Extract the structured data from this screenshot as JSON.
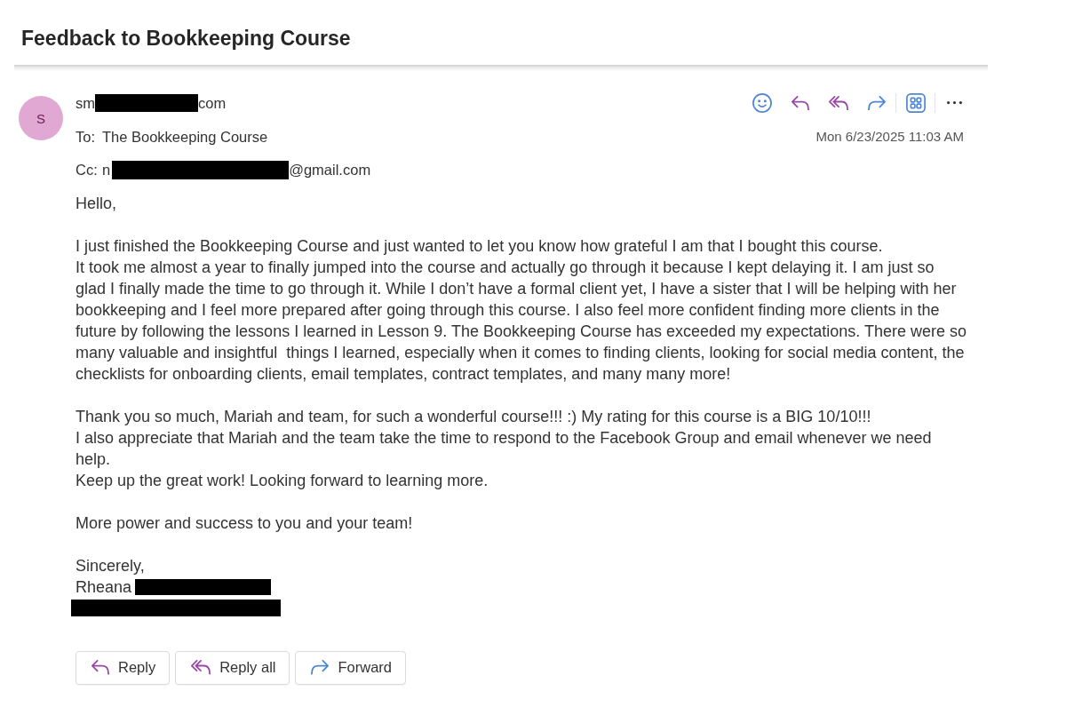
{
  "subject": "Feedback to Bookkeeping Course",
  "message": {
    "avatar_initial": "S",
    "sender": {
      "visible_start": "sm",
      "redacted": true,
      "visible_end": "com"
    },
    "to": {
      "label": "To:",
      "value": "The Bookkeeping Course"
    },
    "cc": {
      "label": "Cc:",
      "visible_start": "n",
      "redacted": true,
      "visible_end": "@gmail.com"
    },
    "date": "Mon 6/23/2025 11:03 AM"
  },
  "body": {
    "greeting": "Hello,",
    "paragraphs": [
      [
        "I just finished the Bookkeeping Course and just wanted to let you know how grateful I am that I bought this course.",
        "It took me almost a year to finally jumped into the course and actually go through it because I kept delaying it. I am just so glad I finally made the time to go through it. While I don’t have a formal client yet, I have a sister that I will be helping with her bookkeeping and I feel more prepared after going through this course. I also feel more confident finding more clients in the future by following the lessons I learned in Lesson 9. The Bookkeeping Course has exceeded my expectations. There were so many valuable and insightful  things I learned, especially when it comes to finding clients, looking for social media content, the checklists for onboarding clients, email templates, contract templates, and many many more!"
      ],
      [
        "Thank you so much, Mariah and team, for such a wonderful course!!! :) My rating for this course is a BIG 10/10!!!",
        "I also appreciate that Mariah and the team take the time to respond to the Facebook Group and email whenever we need help.",
        "Keep up the great work! Looking forward to learning more."
      ],
      [
        "More power and success to you and your team!"
      ]
    ],
    "closing": "Sincerely,",
    "signature": {
      "name": "Rheana",
      "name_redacted": true,
      "second_line_redacted": true
    }
  },
  "actions": [
    {
      "kind": "reply",
      "label": "Reply"
    },
    {
      "kind": "reply_all",
      "label": "Reply all"
    },
    {
      "kind": "forward",
      "label": "Forward"
    }
  ]
}
